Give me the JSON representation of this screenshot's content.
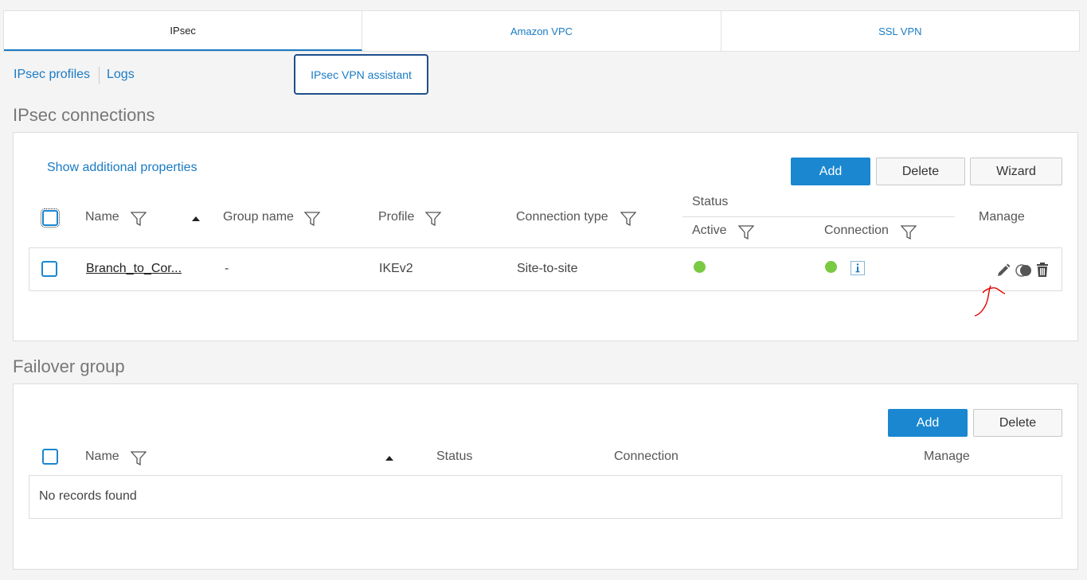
{
  "tabs": [
    {
      "label": "IPsec"
    },
    {
      "label": "Amazon VPC"
    },
    {
      "label": "SSL VPN"
    }
  ],
  "sublinks": {
    "profiles": "IPsec profiles",
    "logs": "Logs",
    "assistant": "IPsec VPN assistant"
  },
  "ipsec": {
    "title": "IPsec connections",
    "show_props": "Show additional properties",
    "buttons": {
      "add": "Add",
      "delete": "Delete",
      "wizard": "Wizard"
    },
    "headers": {
      "name": "Name",
      "group": "Group name",
      "profile": "Profile",
      "conn_type": "Connection type",
      "status": "Status",
      "active": "Active",
      "connection": "Connection",
      "manage": "Manage"
    },
    "rows": [
      {
        "name": "Branch_to_Cor...",
        "group": "-",
        "profile": "IKEv2",
        "conn_type": "Site-to-site",
        "active_color": "#7ac943",
        "connection_color": "#7ac943"
      }
    ]
  },
  "failover": {
    "title": "Failover group",
    "buttons": {
      "add": "Add",
      "delete": "Delete"
    },
    "headers": {
      "name": "Name",
      "status": "Status",
      "connection": "Connection",
      "manage": "Manage"
    },
    "empty": "No records found"
  },
  "icons": {
    "edit": "pencil-icon",
    "toggle": "toggle-icon",
    "delete": "trash-icon",
    "info": "info-icon",
    "filter": "filter-icon"
  },
  "colors": {
    "accent": "#1a87d0",
    "status_green": "#7ac943",
    "annotation": "#e00000"
  }
}
